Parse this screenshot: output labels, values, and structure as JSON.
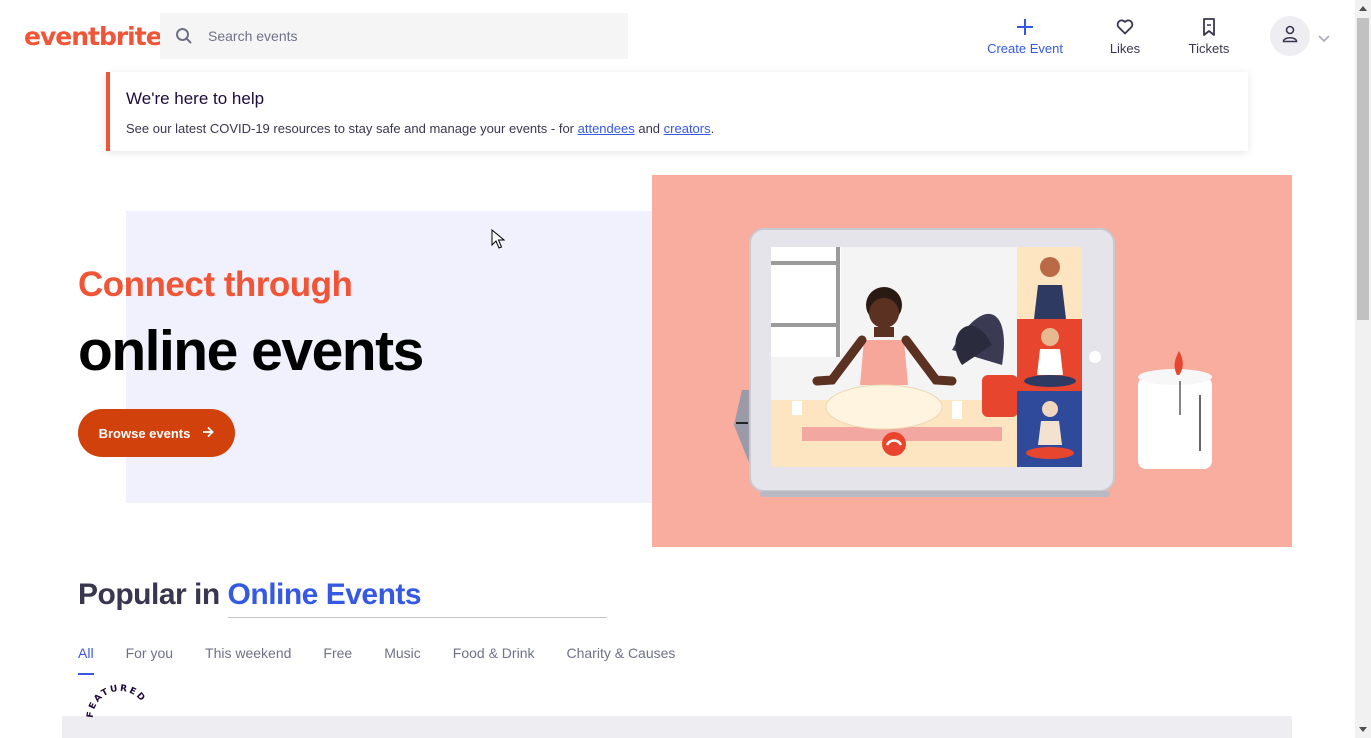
{
  "header": {
    "logo_text": "eventbrite",
    "search_placeholder": "Search events",
    "nav": {
      "create_label": "Create Event",
      "likes_label": "Likes",
      "tickets_label": "Tickets"
    },
    "icons": {
      "search": "search-icon",
      "create": "plus-icon",
      "likes": "heart-icon",
      "tickets": "ticket-icon",
      "avatar": "user-icon",
      "chevron": "chevron-down-icon"
    }
  },
  "banner": {
    "title": "We're here to help",
    "text_before": "See our latest COVID-19 resources to stay safe and manage your events - for ",
    "link_attendees": "attendees",
    "text_middle": " and ",
    "link_creators": "creators",
    "text_after": "."
  },
  "hero": {
    "subtitle": "Connect through",
    "title": "online events",
    "button_label": "Browse events",
    "button_icon": "arrow-right-icon"
  },
  "popular": {
    "prefix": "Popular in",
    "location": "Online Events",
    "tabs": [
      {
        "label": "All",
        "active": true
      },
      {
        "label": "For you",
        "active": false
      },
      {
        "label": "This weekend",
        "active": false
      },
      {
        "label": "Free",
        "active": false
      },
      {
        "label": "Music",
        "active": false
      },
      {
        "label": "Food & Drink",
        "active": false
      },
      {
        "label": "Charity & Causes",
        "active": false
      }
    ],
    "featured_badge": "FEATURED"
  },
  "colors": {
    "brand_orange": "#f05537",
    "accent_blue": "#3659e3",
    "button_orange": "#d1410c",
    "hero_pink": "#f9ad9e",
    "hero_lavender": "#f0f1fd"
  }
}
